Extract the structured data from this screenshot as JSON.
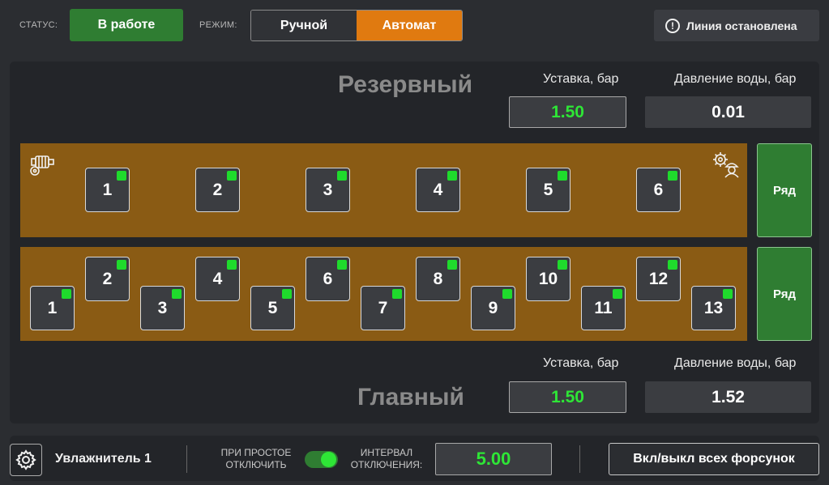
{
  "header": {
    "status_label": "СТАТУС:",
    "status_value": "В работе",
    "mode_label": "РЕЖИМ:",
    "mode_options": [
      "Ручной",
      "Автомат"
    ],
    "mode_selected": "Автомат",
    "line_status": "Линия остановлена"
  },
  "reserve": {
    "title": "Резервный",
    "setpoint_label": "Уставка, бар",
    "setpoint_value": "1.50",
    "pressure_label": "Давление воды, бар",
    "pressure_value": "0.01",
    "row_button": "Ряд",
    "nozzles": [
      "1",
      "2",
      "3",
      "4",
      "5",
      "6"
    ]
  },
  "main_line": {
    "title": "Главный",
    "setpoint_label": "Уставка, бар",
    "setpoint_value": "1.50",
    "pressure_label": "Давление воды, бар",
    "pressure_value": "1.52",
    "row_button": "Ряд",
    "nozzles": [
      "1",
      "2",
      "3",
      "4",
      "5",
      "6",
      "7",
      "8",
      "9",
      "10",
      "11",
      "12",
      "13"
    ]
  },
  "footer": {
    "device_name": "Увлажнитель 1",
    "idle_off_label_1": "ПРИ ПРОСТОЕ",
    "idle_off_label_2": "ОТКЛЮЧИТЬ",
    "idle_off_enabled": true,
    "interval_label_1": "ИНТЕРВАЛ",
    "interval_label_2": "ОТКЛЮЧЕНИЯ:",
    "interval_value": "5.00",
    "all_nozzles_button": "Вкл/выкл всех форсунок"
  },
  "colors": {
    "active_green": "#2f7d32",
    "led_green": "#1fdb2c",
    "mode_active": "#e07a10",
    "row_panel": "#8a5b14"
  },
  "icons": [
    "alert-circle-icon",
    "motor-pump-icon",
    "gear-worker-icon",
    "settings-gear-icon"
  ]
}
